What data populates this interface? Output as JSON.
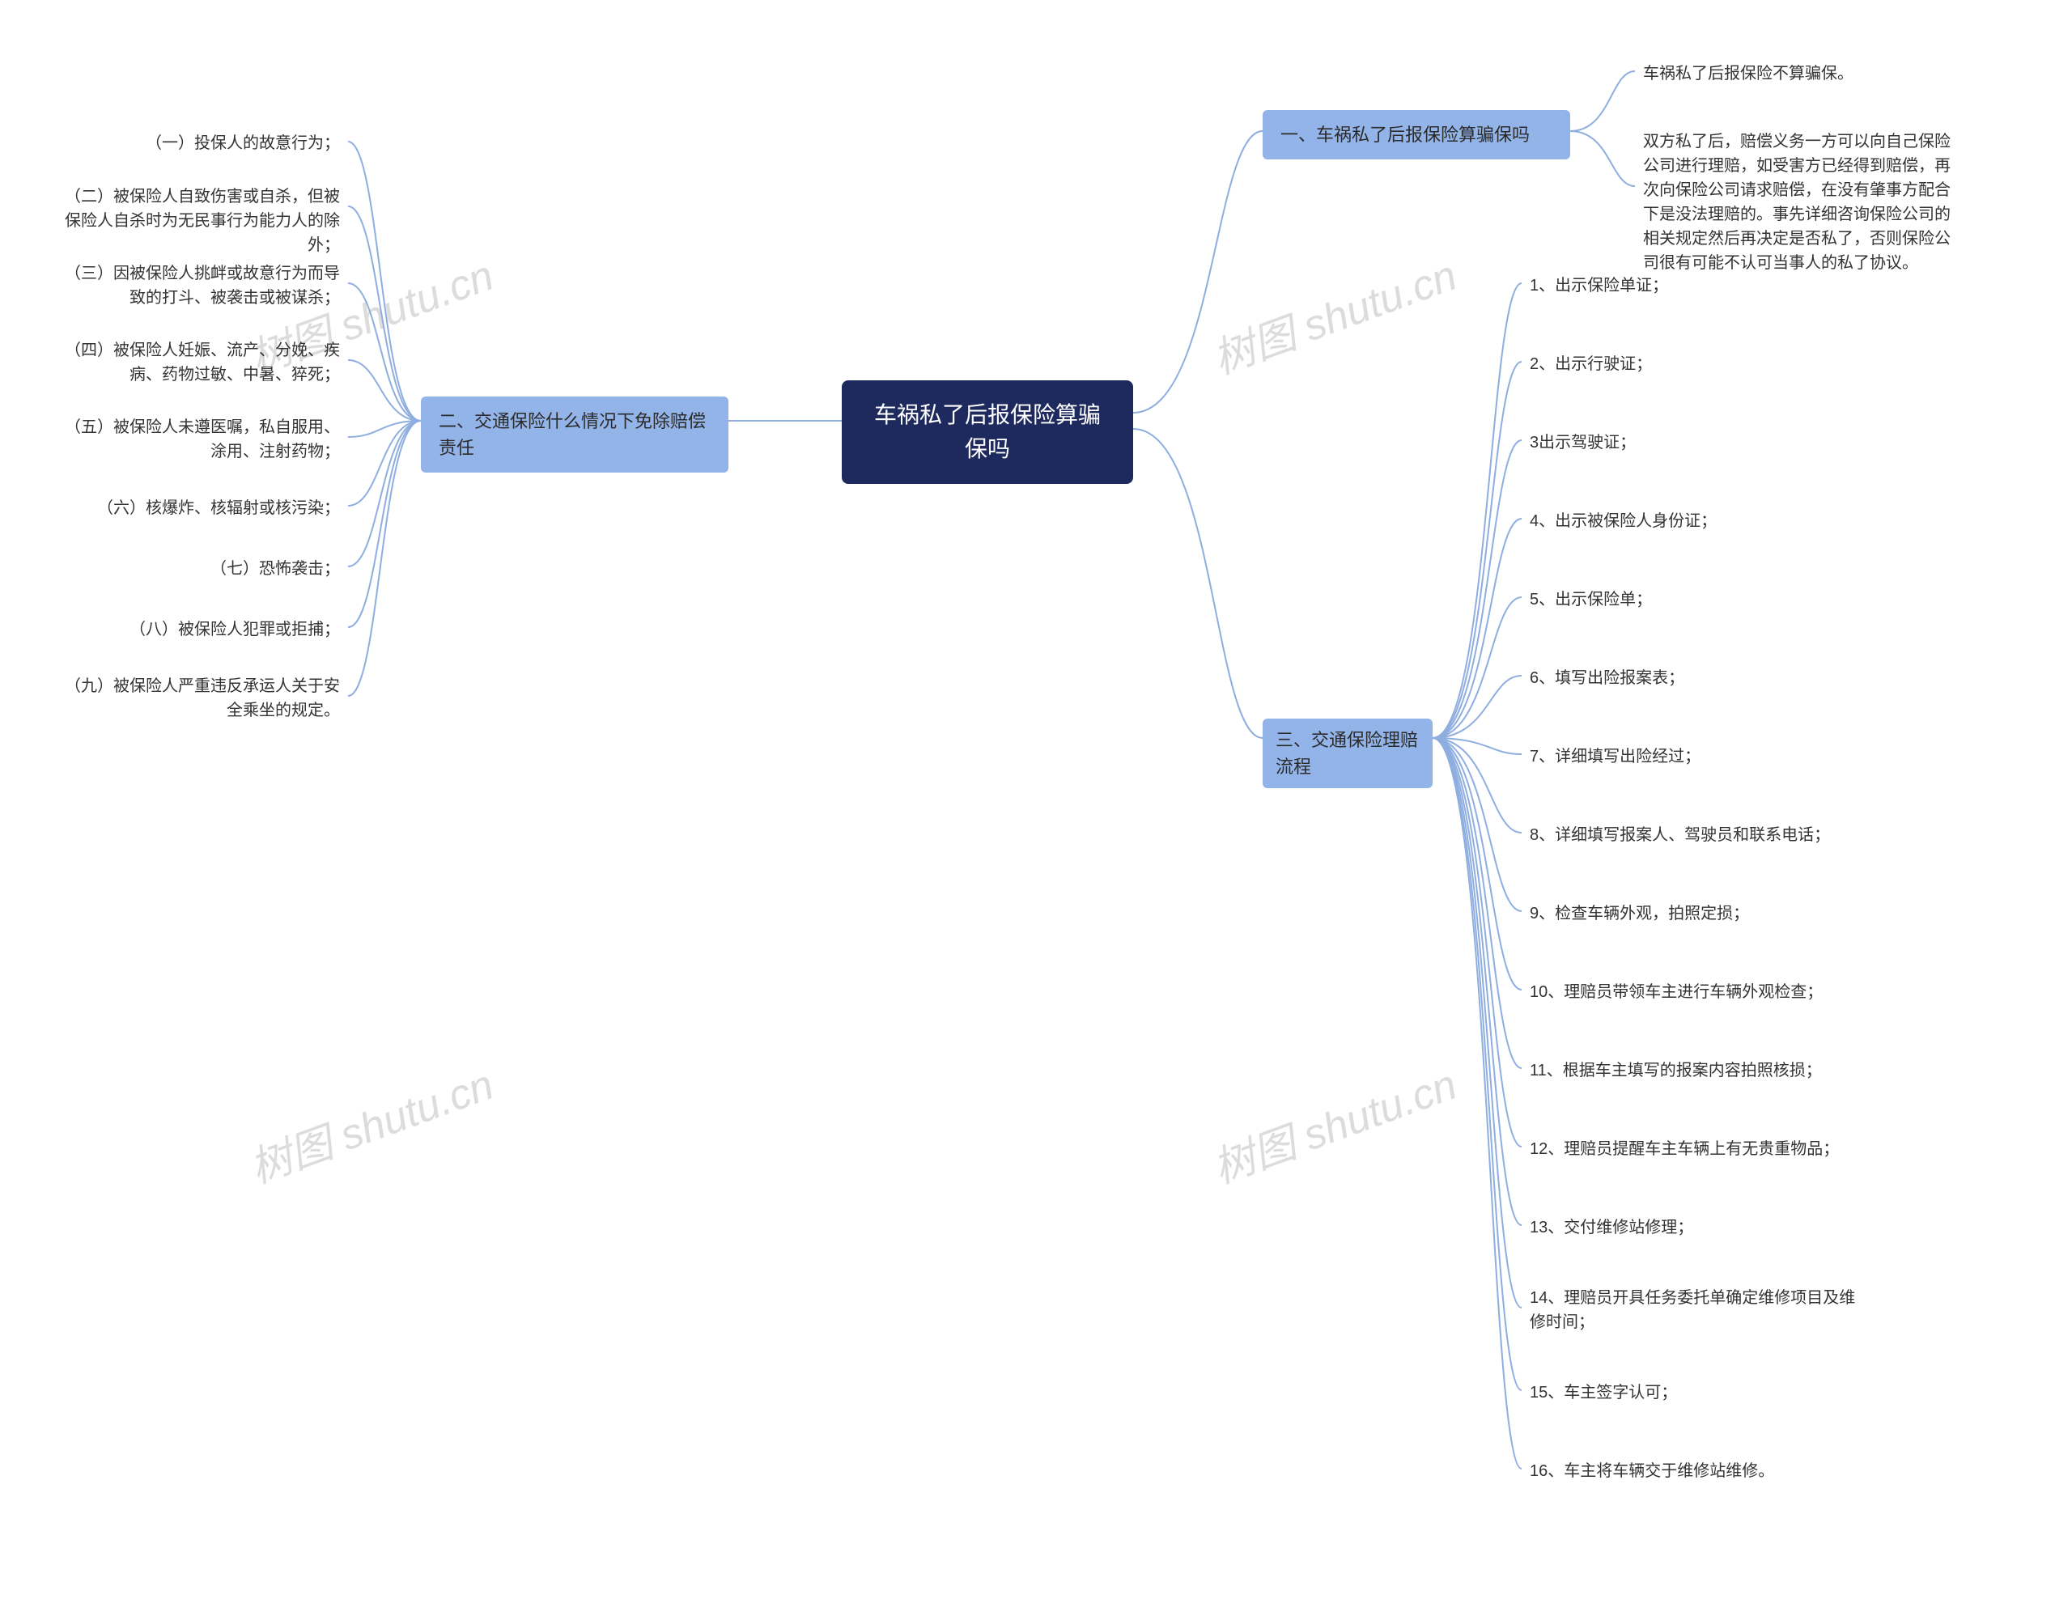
{
  "root": {
    "title": "车祸私了后报保险算骗保吗"
  },
  "branch1": {
    "label": "一、车祸私了后报保险算骗保吗",
    "leaves": [
      "车祸私了后报保险不算骗保。",
      "双方私了后，赔偿义务一方可以向自己保险公司进行理赔，如受害方已经得到赔偿，再次向保险公司请求赔偿，在没有肇事方配合下是没法理赔的。事先详细咨询保险公司的相关规定然后再决定是否私了，否则保险公司很有可能不认可当事人的私了协议。"
    ]
  },
  "branch2": {
    "label": "二、交通保险什么情况下免除赔偿责任",
    "leaves": [
      "（一）投保人的故意行为；",
      "（二）被保险人自致伤害或自杀，但被保险人自杀时为无民事行为能力人的除外；",
      "（三）因被保险人挑衅或故意行为而导致的打斗、被袭击或被谋杀；",
      "（四）被保险人妊娠、流产、分娩、疾病、药物过敏、中暑、猝死；",
      "（五）被保险人未遵医嘱，私自服用、涂用、注射药物；",
      "（六）核爆炸、核辐射或核污染；",
      "（七）恐怖袭击；",
      "（八）被保险人犯罪或拒捕；",
      "（九）被保险人严重违反承运人关于安全乘坐的规定。"
    ]
  },
  "branch3": {
    "label": "三、交通保险理赔流程",
    "leaves": [
      "1、出示保险单证；",
      "2、出示行驶证；",
      "3出示驾驶证；",
      "4、出示被保险人身份证；",
      "5、出示保险单；",
      "6、填写出险报案表；",
      "7、详细填写出险经过；",
      "8、详细填写报案人、驾驶员和联系电话；",
      "9、检查车辆外观，拍照定损；",
      "10、理赔员带领车主进行车辆外观检查；",
      "11、根据车主填写的报案内容拍照核损；",
      "12、理赔员提醒车主车辆上有无贵重物品；",
      "13、交付维修站修理；",
      "14、理赔员开具任务委托单确定维修项目及维修时间；",
      "15、车主签字认可；",
      "16、车主将车辆交于维修站维修。"
    ]
  },
  "watermark": "树图 shutu.cn"
}
